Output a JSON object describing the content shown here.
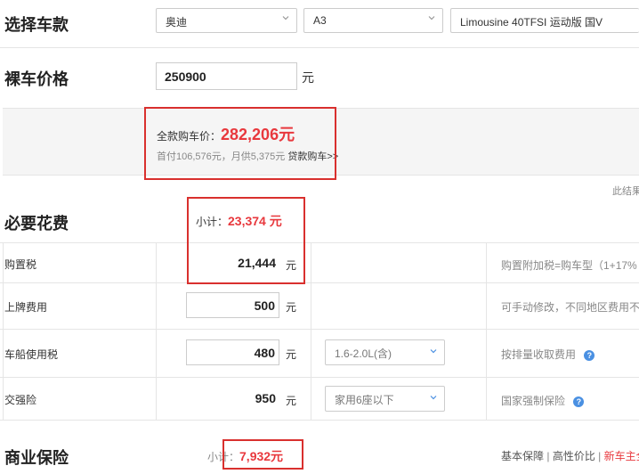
{
  "select_car": {
    "title": "选择车款",
    "brand": "奥迪",
    "model": "A3",
    "version": "Limousine 40TFSI 运动版 国V"
  },
  "bare_price": {
    "title": "裸车价格",
    "value": "250900",
    "unit": "元"
  },
  "summary": {
    "total_label": "全款购车价：",
    "total_value": "282,206元",
    "detail": "首付106,576元，月供5,375元",
    "loan_link": "贷款购车>>",
    "note": "此结果"
  },
  "required": {
    "title": "必要花费",
    "subtotal_label": "小计：",
    "subtotal_value": "23,374 元",
    "rows": [
      {
        "label": "购置税",
        "value": "21,444",
        "unit": "元",
        "hint": "购置附加税=购车型（1+17%"
      },
      {
        "label": "上牌费用",
        "value": "500",
        "unit": "元",
        "hint": "可手动修改，不同地区费用不"
      },
      {
        "label": "车船使用税",
        "value": "480",
        "unit": "元",
        "option": "1.6-2.0L(含)",
        "hint": "按排量收取费用"
      },
      {
        "label": "交强险",
        "value": "950",
        "unit": "元",
        "option": "家用6座以下",
        "hint": "国家强制保险"
      }
    ]
  },
  "commercial": {
    "title": "商业保险",
    "subtotal_label": "小计：",
    "subtotal_value": "7,932元",
    "links": [
      "基本保障",
      "高性价比",
      "新车主全"
    ]
  },
  "colors": {
    "accent_red": "#e8383d",
    "border_red": "#d9302e",
    "help_blue": "#4a90e2"
  }
}
